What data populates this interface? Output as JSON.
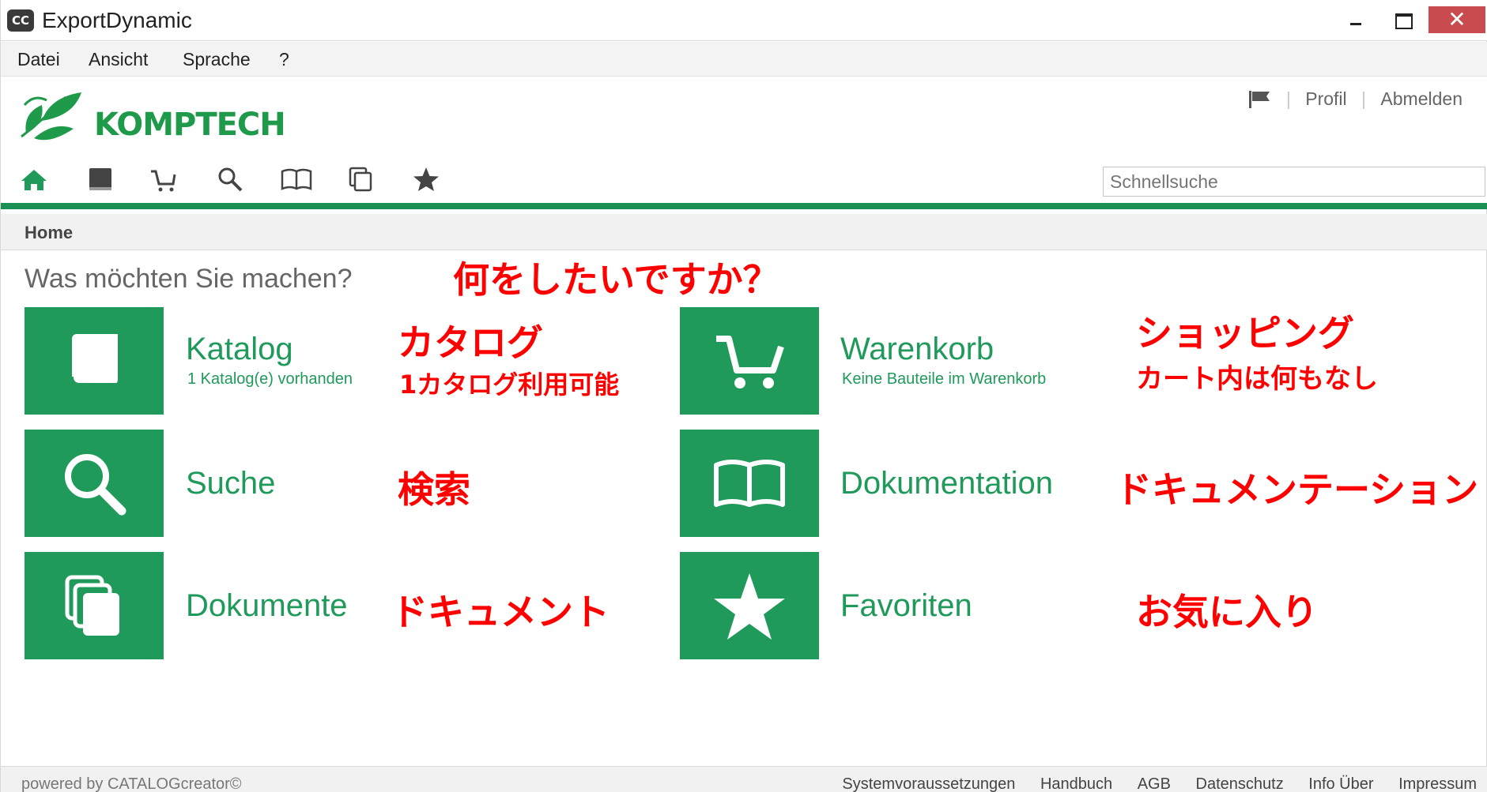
{
  "window": {
    "title": "ExportDynamic",
    "app_icon_glyph": "CC",
    "close_glyph": "✕"
  },
  "menu": {
    "items": [
      "Datei",
      "Ansicht",
      "Sprache",
      "?"
    ]
  },
  "header": {
    "logo_text": "KOMPTECH",
    "profile_link": "Profil",
    "logout_link": "Abmelden",
    "search_placeholder": "Schnellsuche",
    "accent_color": "#1f9a5b",
    "toolbar_icons": [
      "home-icon",
      "book-icon",
      "cart-icon",
      "search-icon",
      "open-book-icon",
      "documents-icon",
      "star-icon"
    ]
  },
  "breadcrumb": "Home",
  "main": {
    "question": "Was möchten Sie machen?",
    "question_jp": "何をしたいですか？",
    "tiles": {
      "katalog": {
        "title": "Katalog",
        "subtitle": "1 Katalog(e) vorhanden",
        "jp_title": "カタログ",
        "jp_sub": "1カタログ利用可能"
      },
      "warenkorb": {
        "title": "Warenkorb",
        "subtitle": "Keine Bauteile im Warenkorb",
        "jp_title": "ショッピング",
        "jp_sub": "カート内は何もなし"
      },
      "suche": {
        "title": "Suche",
        "jp_title": "検索"
      },
      "dokumentation": {
        "title": "Dokumentation",
        "jp_title": "ドキュメンテーション"
      },
      "dokumente": {
        "title": "Dokumente",
        "jp_title": "ドキュメント"
      },
      "favoriten": {
        "title": "Favoriten",
        "jp_title": "お気に入り"
      }
    }
  },
  "footer": {
    "powered": "powered by CATALOGcreator©",
    "links": [
      "Systemvoraussetzungen",
      "Handbuch",
      "AGB",
      "Datenschutz",
      "Info Über",
      "Impressum"
    ]
  }
}
